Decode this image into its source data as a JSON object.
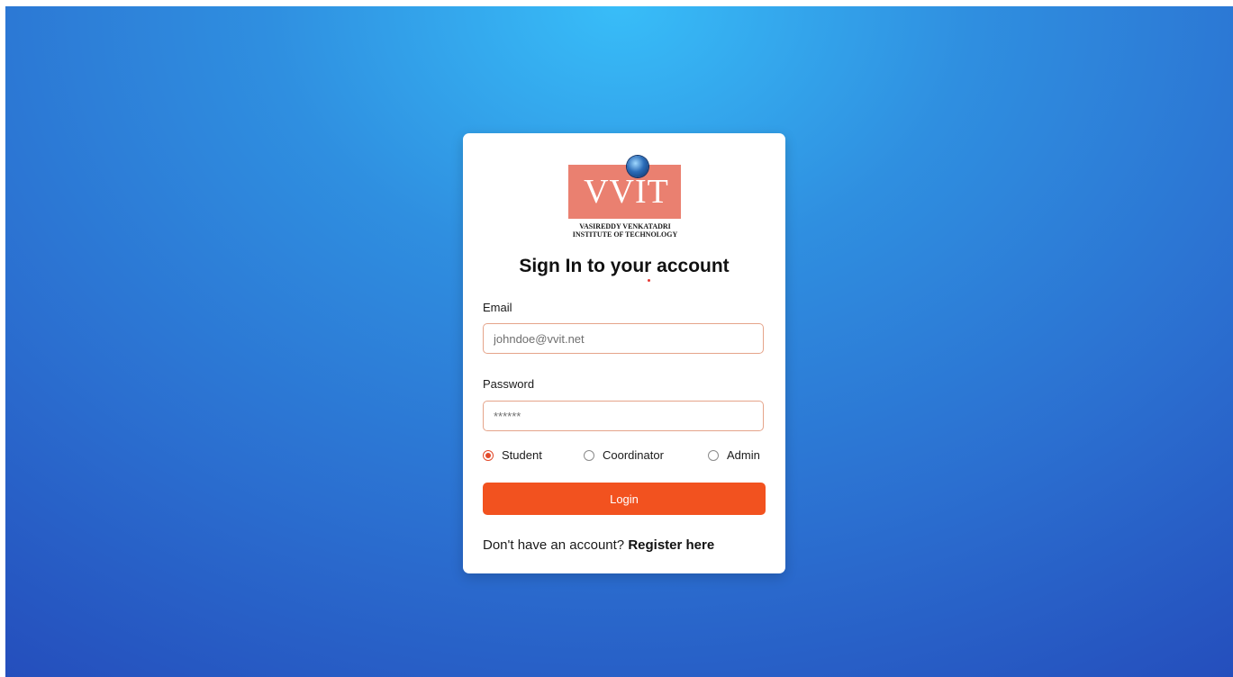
{
  "logo": {
    "text": "VVIT",
    "subtitle_line1": "VASIREDDY VENKATADRI",
    "subtitle_line2": "INSTITUTE OF TECHNOLOGY",
    "box_color": "#ea8070"
  },
  "form": {
    "title": "Sign In to your account",
    "email_label": "Email",
    "email_placeholder": "johndoe@vvit.net",
    "password_label": "Password",
    "password_placeholder": "******",
    "roles": [
      {
        "label": "Student",
        "selected": true
      },
      {
        "label": "Coordinator",
        "selected": false
      },
      {
        "label": "Admin",
        "selected": false
      }
    ],
    "login_label": "Login",
    "register_prompt": "Don't have an account?",
    "register_link": "Register here"
  },
  "colors": {
    "accent": "#f2521f",
    "background_top": "#38bdf8",
    "background_bottom": "#2347b8"
  }
}
